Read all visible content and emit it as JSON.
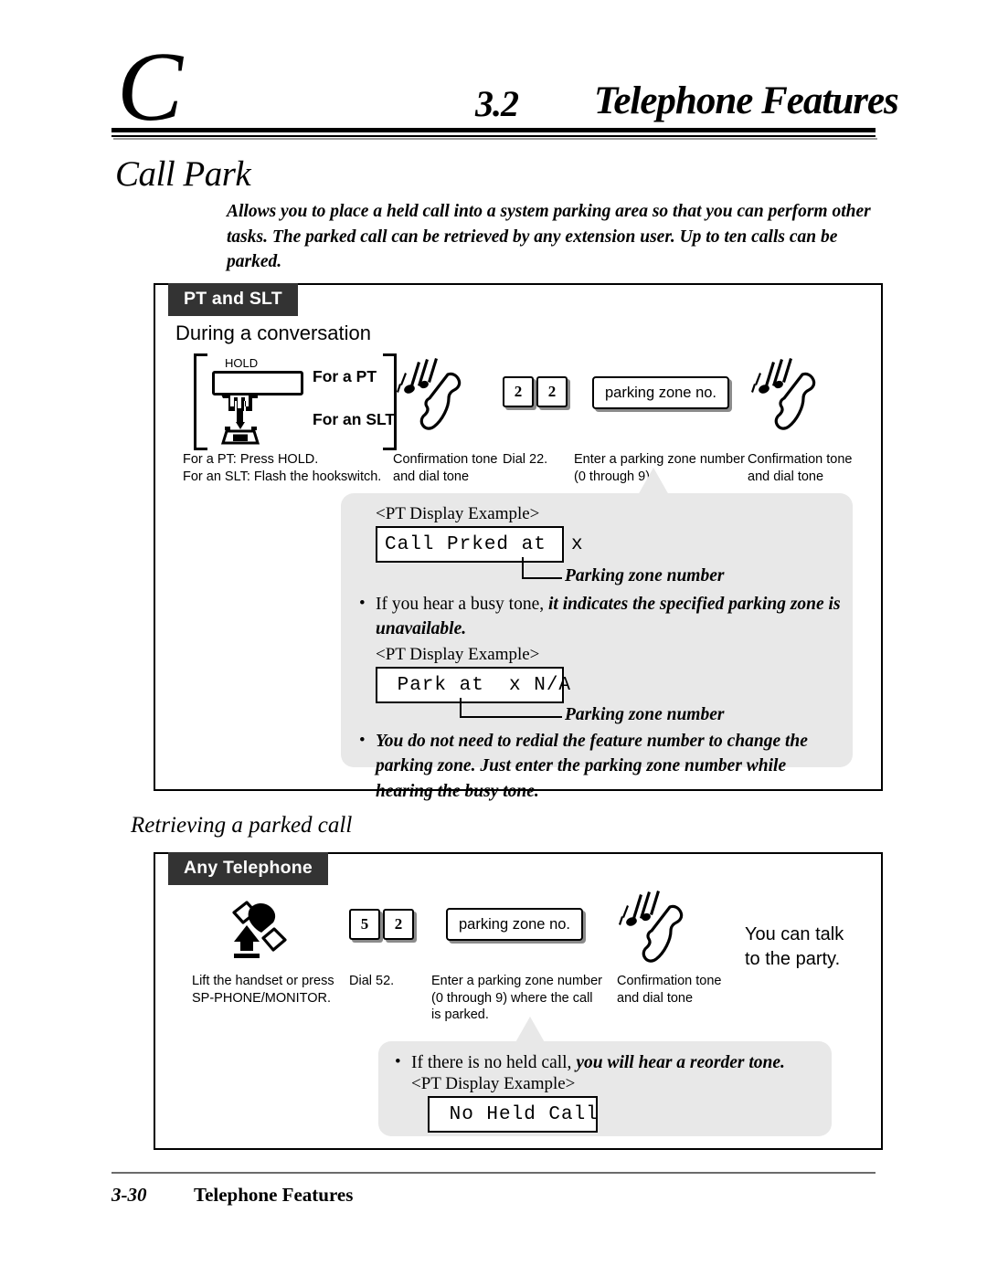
{
  "header": {
    "chapter_letter": "C",
    "section_number": "3.2",
    "section_title": "Telephone Features"
  },
  "feature": {
    "title": "Call Park",
    "description": "Allows you to place a held call into a system parking area so that you can perform other tasks. The parked call can be retrieved by any extension user. Up to ten calls can be parked."
  },
  "procedure_1": {
    "tag": "PT and SLT",
    "subheading": "During a conversation",
    "hold_button_label": "HOLD",
    "for_a_pt_label": "For a PT",
    "for_an_slt_label": "For an SLT",
    "steps": [
      {
        "caption": "For a PT: Press HOLD.\nFor an SLT: Flash the hookswitch.",
        "icon": "hold-button-and-hookswitch-icon"
      },
      {
        "caption": "Confirmation tone\nand dial tone",
        "icon": "ringing-handset-icon"
      },
      {
        "caption": "Dial 22.",
        "icon": "dial-keys",
        "keys": [
          "2",
          "2"
        ]
      },
      {
        "caption": "Enter a parking zone number\n(0 through 9).",
        "icon": "zone-entry-box",
        "box_label": "parking zone no."
      },
      {
        "caption": "Confirmation tone\nand dial tone",
        "icon": "ringing-handset-icon"
      }
    ],
    "note": {
      "display_example_label_1": "<PT Display Example>",
      "lcd_1": "Call Prked at  x",
      "leader_label_1": "Parking zone number",
      "bullet_1_plain": "If you hear a busy tone,",
      "bullet_1_bold": "it indicates the specified parking zone is unavailable.",
      "display_example_label_2": "<PT Display Example>",
      "lcd_2": " Park at  x N/A",
      "leader_label_2": "Parking zone number",
      "bullet_2_bold": "You do not need to redial the feature number to change the parking zone. Just enter the parking zone number while hearing the busy tone."
    }
  },
  "retrieve_section_label": "Retrieving a parked call",
  "procedure_2": {
    "tag": "Any Telephone",
    "steps": [
      {
        "caption": "Lift the handset or press\nSP-PHONE/MONITOR.",
        "icon": "lift-handset-icon"
      },
      {
        "caption": "Dial 52.",
        "icon": "dial-keys",
        "keys": [
          "5",
          "2"
        ]
      },
      {
        "caption": "Enter a parking zone number\n(0 through 9) where the call\nis parked.",
        "icon": "zone-entry-box",
        "box_label": "parking zone no."
      },
      {
        "caption": "Confirmation tone\nand dial tone",
        "icon": "ringing-handset-icon"
      }
    ],
    "result_text": "You can talk\nto the party.",
    "note": {
      "bullet_plain": "If there is no held call,",
      "bullet_bold": "you will hear a reorder tone.",
      "display_example_label": "<PT Display Example>",
      "lcd": " No Held Call"
    }
  },
  "footer": {
    "page_number": "3-30",
    "title": "Telephone Features"
  },
  "colors": {
    "note_bg": "#e8e8e8",
    "tag_bg": "#333333",
    "rule": "#000000",
    "key_shadow": "#8b8b8b"
  }
}
